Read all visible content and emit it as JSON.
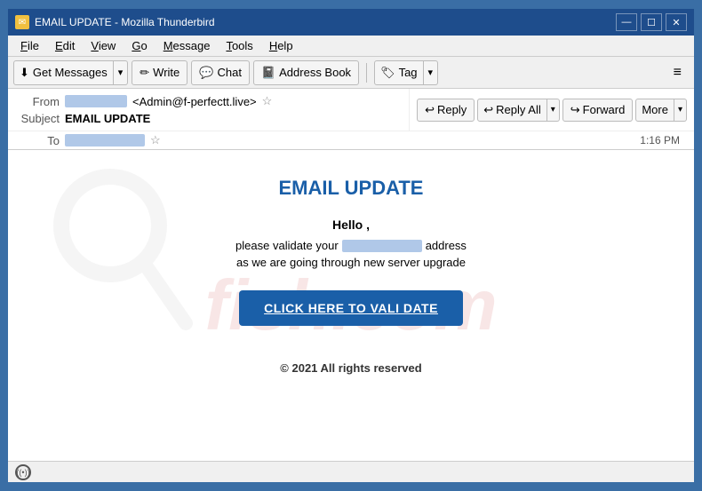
{
  "window": {
    "title": "EMAIL UPDATE - Mozilla Thunderbird",
    "icon": "✉"
  },
  "titlebar": {
    "controls": {
      "minimize": "—",
      "maximize": "☐",
      "close": "✕"
    }
  },
  "menubar": {
    "items": [
      {
        "label": "File",
        "underline": "F"
      },
      {
        "label": "Edit",
        "underline": "E"
      },
      {
        "label": "View",
        "underline": "V"
      },
      {
        "label": "Go",
        "underline": "G"
      },
      {
        "label": "Message",
        "underline": "M"
      },
      {
        "label": "Tools",
        "underline": "T"
      },
      {
        "label": "Help",
        "underline": "H"
      }
    ]
  },
  "toolbar": {
    "get_messages": "Get Messages",
    "write": "Write",
    "chat": "Chat",
    "address_book": "Address Book",
    "tag": "Tag",
    "hamburger": "≡"
  },
  "email_header": {
    "from_label": "From",
    "from_value": "<Admin@f-perfectt.live>",
    "subject_label": "Subject",
    "subject_value": "EMAIL UPDATE",
    "to_label": "To",
    "time": "1:16 PM",
    "actions": {
      "reply": "Reply",
      "reply_all": "Reply All",
      "forward": "Forward",
      "more": "More"
    }
  },
  "email_body": {
    "title": "EMAIL UPDATE",
    "hello": "Hello ,",
    "line1_before": "please validate your",
    "line1_after": "address",
    "line2": "as we are going through new server upgrade",
    "button": "CLICK HERE TO VALI DATE",
    "copyright": "© 2021 All rights reserved"
  },
  "watermark": {
    "text": "fish.com"
  },
  "statusbar": {
    "icon": "((•))"
  }
}
